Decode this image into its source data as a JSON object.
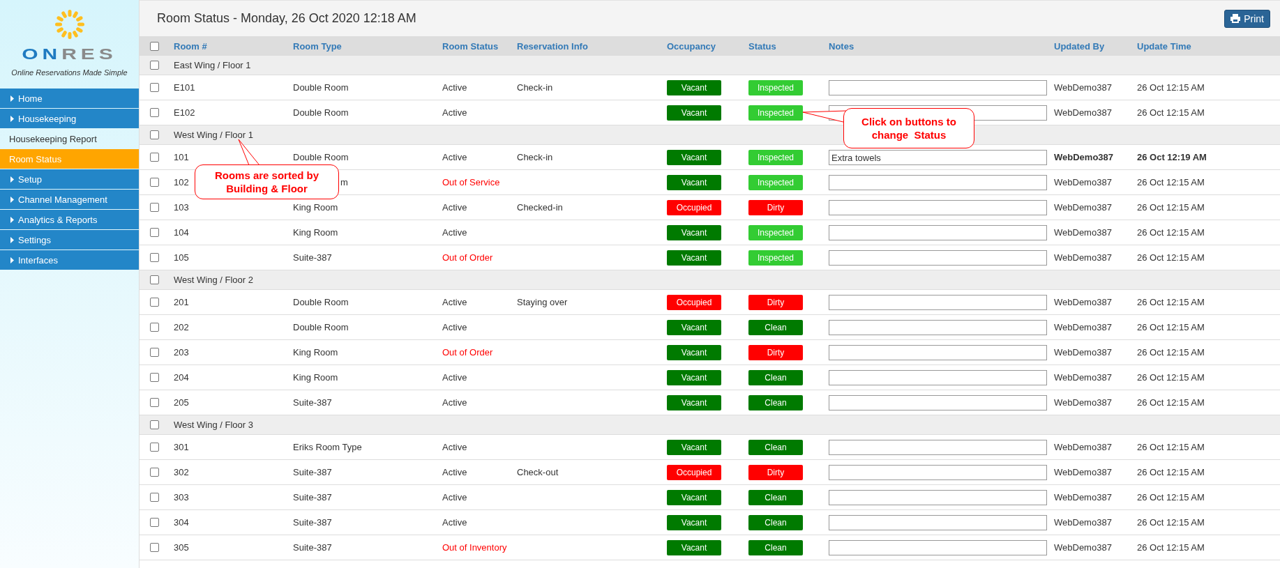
{
  "logo": {
    "wordmark_lead": "ON",
    "wordmark_rest": "RES",
    "tagline": "Online Reservations Made Simple"
  },
  "sidebar": {
    "items": [
      {
        "label": "Home",
        "kind": "menu",
        "selected": false
      },
      {
        "label": "Housekeeping",
        "kind": "menu",
        "selected": false
      },
      {
        "label": "Housekeeping Report",
        "kind": "submenu",
        "selected": false
      },
      {
        "label": "Room Status",
        "kind": "submenu",
        "selected": true
      },
      {
        "label": "Setup",
        "kind": "menu",
        "selected": false
      },
      {
        "label": "Channel Management",
        "kind": "menu",
        "selected": false
      },
      {
        "label": "Analytics & Reports",
        "kind": "menu",
        "selected": false
      },
      {
        "label": "Settings",
        "kind": "menu",
        "selected": false
      },
      {
        "label": "Interfaces",
        "kind": "menu",
        "selected": false
      }
    ]
  },
  "header": {
    "title": "Room Status - Monday, 26 Oct 2020 12:18 AM",
    "print_button": "Print"
  },
  "table": {
    "select_all_checked": false,
    "columns": [
      "Room #",
      "Room Type",
      "Room Status",
      "Reservation Info",
      "Occupancy",
      "Status",
      "Notes",
      "Updated By",
      "Update Time"
    ],
    "groups": [
      {
        "label": "East Wing / Floor 1",
        "checked": false,
        "rooms": [
          {
            "room": "E101",
            "type": "Double Room",
            "room_status": "Active",
            "alert": false,
            "reservation": "Check-in",
            "occupancy": {
              "text": "Vacant",
              "color": "#007a00"
            },
            "status": {
              "text": "Inspected",
              "color": "#33cc33"
            },
            "updated_by": "WebDemo387",
            "update_time": "26 Oct 12:15 AM",
            "recent": false,
            "checked": false
          },
          {
            "room": "E102",
            "type": "Double Room",
            "room_status": "Active",
            "alert": false,
            "occupancy": {
              "text": "Vacant",
              "color": "#007a00"
            },
            "status": {
              "text": "Inspected",
              "color": "#33cc33"
            },
            "updated_by": "WebDemo387",
            "update_time": "26 Oct 12:15 AM",
            "recent": false,
            "checked": false
          }
        ]
      },
      {
        "label": "West Wing / Floor 1",
        "checked": false,
        "rooms": [
          {
            "room": "101",
            "type": "Double Room",
            "room_status": "Active",
            "alert": false,
            "reservation": "Check-in",
            "occupancy": {
              "text": "Vacant",
              "color": "#007a00"
            },
            "status": {
              "text": "Inspected",
              "color": "#33cc33"
            },
            "notes": "Extra towels",
            "updated_by": "WebDemo387",
            "update_time": "26 Oct 12:19 AM",
            "recent": true,
            "checked": false
          },
          {
            "room": "102",
            "type": "m",
            "type_shows_end": true,
            "room_status": "Out of Service",
            "alert": true,
            "occupancy": {
              "text": "Vacant",
              "color": "#007a00"
            },
            "status": {
              "text": "Inspected",
              "color": "#33cc33"
            },
            "updated_by": "WebDemo387",
            "update_time": "26 Oct 12:15 AM",
            "recent": false,
            "checked": false
          },
          {
            "room": "103",
            "type": "King Room",
            "room_status": "Active",
            "alert": false,
            "reservation": "Checked-in",
            "occupancy": {
              "text": "Occupied",
              "color": "#ff0000"
            },
            "status": {
              "text": "Dirty",
              "color": "#ff0000"
            },
            "updated_by": "WebDemo387",
            "update_time": "26 Oct 12:15 AM",
            "recent": false,
            "checked": false
          },
          {
            "room": "104",
            "type": "King Room",
            "room_status": "Active",
            "alert": false,
            "occupancy": {
              "text": "Vacant",
              "color": "#007a00"
            },
            "status": {
              "text": "Inspected",
              "color": "#33cc33"
            },
            "updated_by": "WebDemo387",
            "update_time": "26 Oct 12:15 AM",
            "recent": false,
            "checked": false
          },
          {
            "room": "105",
            "type": "Suite-387",
            "room_status": "Out of Order",
            "alert": true,
            "occupancy": {
              "text": "Vacant",
              "color": "#007a00"
            },
            "status": {
              "text": "Inspected",
              "color": "#33cc33"
            },
            "updated_by": "WebDemo387",
            "update_time": "26 Oct 12:15 AM",
            "recent": false,
            "checked": false
          }
        ]
      },
      {
        "label": "West Wing / Floor 2",
        "checked": false,
        "rooms": [
          {
            "room": "201",
            "type": "Double Room",
            "room_status": "Active",
            "alert": false,
            "reservation": "Staying over",
            "occupancy": {
              "text": "Occupied",
              "color": "#ff0000"
            },
            "status": {
              "text": "Dirty",
              "color": "#ff0000"
            },
            "updated_by": "WebDemo387",
            "update_time": "26 Oct 12:15 AM",
            "recent": false,
            "checked": false
          },
          {
            "room": "202",
            "type": "Double Room",
            "room_status": "Active",
            "alert": false,
            "occupancy": {
              "text": "Vacant",
              "color": "#007a00"
            },
            "status": {
              "text": "Clean",
              "color": "#007a00"
            },
            "updated_by": "WebDemo387",
            "update_time": "26 Oct 12:15 AM",
            "recent": false,
            "checked": false
          },
          {
            "room": "203",
            "type": "King Room",
            "room_status": "Out of Order",
            "alert": true,
            "occupancy": {
              "text": "Vacant",
              "color": "#007a00"
            },
            "status": {
              "text": "Dirty",
              "color": "#ff0000"
            },
            "updated_by": "WebDemo387",
            "update_time": "26 Oct 12:15 AM",
            "recent": false,
            "checked": false
          },
          {
            "room": "204",
            "type": "King Room",
            "room_status": "Active",
            "alert": false,
            "occupancy": {
              "text": "Vacant",
              "color": "#007a00"
            },
            "status": {
              "text": "Clean",
              "color": "#007a00"
            },
            "updated_by": "WebDemo387",
            "update_time": "26 Oct 12:15 AM",
            "recent": false,
            "checked": false
          },
          {
            "room": "205",
            "type": "Suite-387",
            "room_status": "Active",
            "alert": false,
            "occupancy": {
              "text": "Vacant",
              "color": "#007a00"
            },
            "status": {
              "text": "Clean",
              "color": "#007a00"
            },
            "updated_by": "WebDemo387",
            "update_time": "26 Oct 12:15 AM",
            "recent": false,
            "checked": false
          }
        ]
      },
      {
        "label": "West Wing / Floor 3",
        "checked": false,
        "rooms": [
          {
            "room": "301",
            "type": "Eriks Room Type",
            "room_status": "Active",
            "alert": false,
            "occupancy": {
              "text": "Vacant",
              "color": "#007a00"
            },
            "status": {
              "text": "Clean",
              "color": "#007a00"
            },
            "updated_by": "WebDemo387",
            "update_time": "26 Oct 12:15 AM",
            "recent": false,
            "checked": false
          },
          {
            "room": "302",
            "type": "Suite-387",
            "room_status": "Active",
            "alert": false,
            "reservation": "Check-out",
            "occupancy": {
              "text": "Occupied",
              "color": "#ff0000"
            },
            "status": {
              "text": "Dirty",
              "color": "#ff0000"
            },
            "updated_by": "WebDemo387",
            "update_time": "26 Oct 12:15 AM",
            "recent": false,
            "checked": false
          },
          {
            "room": "303",
            "type": "Suite-387",
            "room_status": "Active",
            "alert": false,
            "occupancy": {
              "text": "Vacant",
              "color": "#007a00"
            },
            "status": {
              "text": "Clean",
              "color": "#007a00"
            },
            "updated_by": "WebDemo387",
            "update_time": "26 Oct 12:15 AM",
            "recent": false,
            "checked": false
          },
          {
            "room": "304",
            "type": "Suite-387",
            "room_status": "Active",
            "alert": false,
            "occupancy": {
              "text": "Vacant",
              "color": "#007a00"
            },
            "status": {
              "text": "Clean",
              "color": "#007a00"
            },
            "updated_by": "WebDemo387",
            "update_time": "26 Oct 12:15 AM",
            "recent": false,
            "checked": false
          },
          {
            "room": "305",
            "type": "Suite-387",
            "room_status": "Out of Inventory",
            "alert": true,
            "occupancy": {
              "text": "Vacant",
              "color": "#007a00"
            },
            "status": {
              "text": "Clean",
              "color": "#007a00"
            },
            "updated_by": "WebDemo387",
            "update_time": "26 Oct 12:15 AM",
            "recent": false,
            "checked": false
          }
        ]
      }
    ]
  },
  "callouts": [
    {
      "text": "Rooms are sorted by Building & Floor"
    },
    {
      "text": "Click on buttons to change  Status"
    }
  ]
}
